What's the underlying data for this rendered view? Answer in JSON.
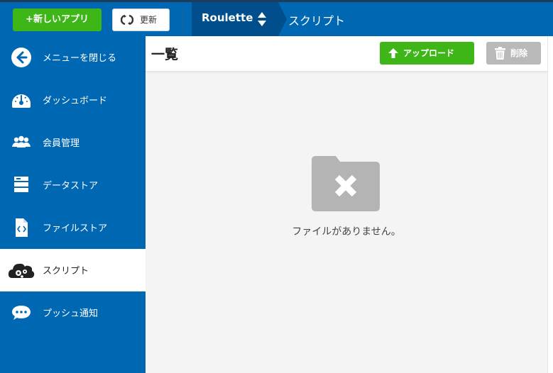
{
  "topbar": {
    "new_app_label": "+新しいアプリ",
    "refresh_label": "更新",
    "app_name": "Roulette",
    "breadcrumb": "スクリプト"
  },
  "sidebar": {
    "items": [
      {
        "label": "メニューを閉じる",
        "icon": "arrow-left-circle-icon"
      },
      {
        "label": "ダッシュボード",
        "icon": "dashboard-gauge-icon"
      },
      {
        "label": "会員管理",
        "icon": "users-icon"
      },
      {
        "label": "データストア",
        "icon": "datastore-icon"
      },
      {
        "label": "ファイルストア",
        "icon": "code-file-icon"
      },
      {
        "label": "スクリプト",
        "icon": "cloud-gears-icon",
        "active": true
      },
      {
        "label": "プッシュ通知",
        "icon": "chat-bubble-icon"
      }
    ]
  },
  "main": {
    "title": "一覧",
    "upload_label": "アップロード",
    "delete_label": "削除",
    "empty_message": "ファイルがありません。"
  },
  "colors": {
    "brand_blue": "#0067b3",
    "dark_blue": "#004f8c",
    "accent_green": "#3fb618",
    "disabled_gray": "#b9b9b9",
    "panel_bg": "#f4f4f4"
  }
}
